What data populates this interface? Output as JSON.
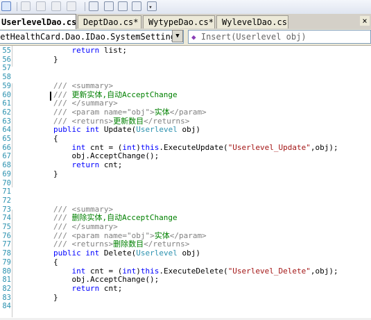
{
  "toolbar": {
    "icons": [
      "comment-lines-icon",
      "uncomment-icon",
      "bookmark-icon",
      "prev-bookmark-icon",
      "next-bookmark-icon",
      "clear-bookmarks-icon",
      "outdent-icon",
      "indent-icon",
      "comment-icon",
      "uncomment-selection-icon"
    ],
    "overflow_glyph": "▾"
  },
  "tabs": [
    {
      "label": "UserlevelDao.cs*",
      "active": true
    },
    {
      "label": "DeptDao.cs*",
      "active": false
    },
    {
      "label": "WytypeDao.cs*",
      "active": false
    },
    {
      "label": "WylevelDao.cs*",
      "active": false
    }
  ],
  "tab_close_glyph": "×",
  "navbar": {
    "class_combo": "NetHealthCard.Dao.IDao.SystemSetting.Userle",
    "member_combo": "Insert(Userlevel obj)",
    "dropdown_glyph": "▼"
  },
  "lines": [
    {
      "n": "55",
      "tokens": [
        {
          "t": "            ",
          "c": "plain"
        },
        {
          "t": "return",
          "c": "kw"
        },
        {
          "t": " list;",
          "c": "plain"
        }
      ]
    },
    {
      "n": "56",
      "tokens": [
        {
          "t": "        }",
          "c": "plain"
        }
      ]
    },
    {
      "n": "57",
      "tokens": []
    },
    {
      "n": "58",
      "tokens": []
    },
    {
      "n": "59",
      "tokens": [
        {
          "t": "        ",
          "c": "plain"
        },
        {
          "t": "/// ",
          "c": "doc"
        },
        {
          "t": "<summary>",
          "c": "doc"
        }
      ]
    },
    {
      "n": "60",
      "tokens": [
        {
          "t": "        ",
          "c": "plain"
        },
        {
          "t": "/// ",
          "c": "doc"
        },
        {
          "t": "更新实体,自动AcceptChange",
          "c": "cmt"
        }
      ]
    },
    {
      "n": "61",
      "tokens": [
        {
          "t": "        ",
          "c": "plain"
        },
        {
          "t": "/// ",
          "c": "doc"
        },
        {
          "t": "</summary>",
          "c": "doc"
        }
      ]
    },
    {
      "n": "62",
      "tokens": [
        {
          "t": "        ",
          "c": "plain"
        },
        {
          "t": "/// ",
          "c": "doc"
        },
        {
          "t": "<param name=\"obj\">",
          "c": "doc"
        },
        {
          "t": "实体",
          "c": "cmt"
        },
        {
          "t": "</param>",
          "c": "doc"
        }
      ]
    },
    {
      "n": "63",
      "tokens": [
        {
          "t": "        ",
          "c": "plain"
        },
        {
          "t": "/// ",
          "c": "doc"
        },
        {
          "t": "<returns>",
          "c": "doc"
        },
        {
          "t": "更新数目",
          "c": "cmt"
        },
        {
          "t": "</returns>",
          "c": "doc"
        }
      ]
    },
    {
      "n": "64",
      "tokens": [
        {
          "t": "        ",
          "c": "plain"
        },
        {
          "t": "public",
          "c": "kw"
        },
        {
          "t": " ",
          "c": "plain"
        },
        {
          "t": "int",
          "c": "kw"
        },
        {
          "t": " Update(",
          "c": "plain"
        },
        {
          "t": "Userlevel",
          "c": "type"
        },
        {
          "t": " obj)",
          "c": "plain"
        }
      ]
    },
    {
      "n": "65",
      "tokens": [
        {
          "t": "        {",
          "c": "plain"
        }
      ]
    },
    {
      "n": "66",
      "tokens": [
        {
          "t": "            ",
          "c": "plain"
        },
        {
          "t": "int",
          "c": "kw"
        },
        {
          "t": " cnt = (",
          "c": "plain"
        },
        {
          "t": "int",
          "c": "kw"
        },
        {
          "t": ")",
          "c": "plain"
        },
        {
          "t": "this",
          "c": "kw"
        },
        {
          "t": ".ExecuteUpdate(",
          "c": "plain"
        },
        {
          "t": "\"Userlevel_Update\"",
          "c": "str"
        },
        {
          "t": ",obj);",
          "c": "plain"
        }
      ]
    },
    {
      "n": "67",
      "tokens": [
        {
          "t": "            obj.AcceptChange();",
          "c": "plain"
        }
      ]
    },
    {
      "n": "68",
      "tokens": [
        {
          "t": "            ",
          "c": "plain"
        },
        {
          "t": "return",
          "c": "kw"
        },
        {
          "t": " cnt;",
          "c": "plain"
        }
      ]
    },
    {
      "n": "69",
      "tokens": [
        {
          "t": "        }",
          "c": "plain"
        }
      ]
    },
    {
      "n": "70",
      "tokens": []
    },
    {
      "n": "71",
      "tokens": []
    },
    {
      "n": "72",
      "tokens": []
    },
    {
      "n": "73",
      "tokens": [
        {
          "t": "        ",
          "c": "plain"
        },
        {
          "t": "/// ",
          "c": "doc"
        },
        {
          "t": "<summary>",
          "c": "doc"
        }
      ]
    },
    {
      "n": "74",
      "tokens": [
        {
          "t": "        ",
          "c": "plain"
        },
        {
          "t": "/// ",
          "c": "doc"
        },
        {
          "t": "删除实体,自动AcceptChange",
          "c": "cmt"
        }
      ]
    },
    {
      "n": "75",
      "tokens": [
        {
          "t": "        ",
          "c": "plain"
        },
        {
          "t": "/// ",
          "c": "doc"
        },
        {
          "t": "</summary>",
          "c": "doc"
        }
      ]
    },
    {
      "n": "76",
      "tokens": [
        {
          "t": "        ",
          "c": "plain"
        },
        {
          "t": "/// ",
          "c": "doc"
        },
        {
          "t": "<param name=\"obj\">",
          "c": "doc"
        },
        {
          "t": "实体",
          "c": "cmt"
        },
        {
          "t": "</param>",
          "c": "doc"
        }
      ]
    },
    {
      "n": "77",
      "tokens": [
        {
          "t": "        ",
          "c": "plain"
        },
        {
          "t": "/// ",
          "c": "doc"
        },
        {
          "t": "<returns>",
          "c": "doc"
        },
        {
          "t": "删除数目",
          "c": "cmt"
        },
        {
          "t": "</returns>",
          "c": "doc"
        }
      ]
    },
    {
      "n": "78",
      "tokens": [
        {
          "t": "        ",
          "c": "plain"
        },
        {
          "t": "public",
          "c": "kw"
        },
        {
          "t": " ",
          "c": "plain"
        },
        {
          "t": "int",
          "c": "kw"
        },
        {
          "t": " Delete(",
          "c": "plain"
        },
        {
          "t": "Userlevel",
          "c": "type"
        },
        {
          "t": " obj)",
          "c": "plain"
        }
      ]
    },
    {
      "n": "79",
      "tokens": [
        {
          "t": "        {",
          "c": "plain"
        }
      ]
    },
    {
      "n": "80",
      "tokens": [
        {
          "t": "            ",
          "c": "plain"
        },
        {
          "t": "int",
          "c": "kw"
        },
        {
          "t": " cnt = (",
          "c": "plain"
        },
        {
          "t": "int",
          "c": "kw"
        },
        {
          "t": ")",
          "c": "plain"
        },
        {
          "t": "this",
          "c": "kw"
        },
        {
          "t": ".ExecuteDelete(",
          "c": "plain"
        },
        {
          "t": "\"Userlevel_Delete\"",
          "c": "str"
        },
        {
          "t": ",obj);",
          "c": "plain"
        }
      ]
    },
    {
      "n": "81",
      "tokens": [
        {
          "t": "            obj.AcceptChange();",
          "c": "plain"
        }
      ]
    },
    {
      "n": "82",
      "tokens": [
        {
          "t": "            ",
          "c": "plain"
        },
        {
          "t": "return",
          "c": "kw"
        },
        {
          "t": " cnt;",
          "c": "plain"
        }
      ]
    },
    {
      "n": "83",
      "tokens": [
        {
          "t": "        }",
          "c": "plain"
        }
      ]
    },
    {
      "n": "84",
      "tokens": []
    }
  ]
}
